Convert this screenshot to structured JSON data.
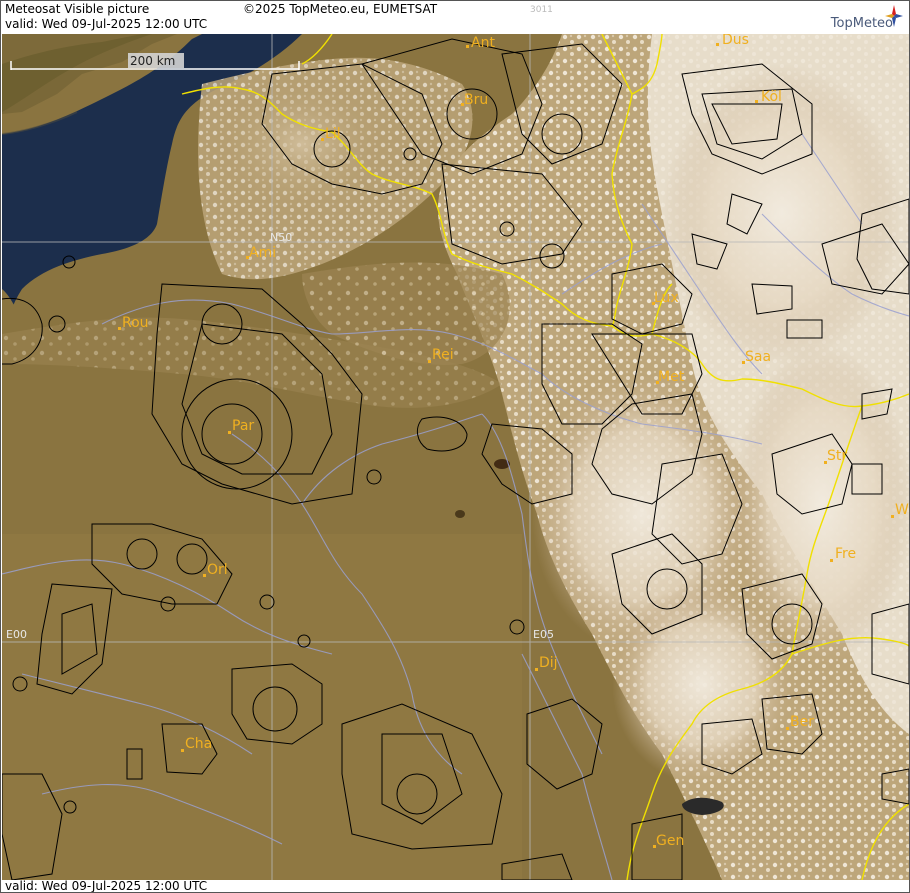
{
  "header": {
    "title": "Meteosat Visible picture",
    "valid": "valid:  Wed  09-Jul-2025  12:00 UTC",
    "copyright": "©2025 TopMeteo.eu, EUMETSAT",
    "code": "3011",
    "logo": "TopMeteo"
  },
  "footer": {
    "valid": "valid:  Wed  09-Jul-2025  12:00 UTC"
  },
  "scale": {
    "label": "200 km"
  },
  "grid_labels": {
    "n50": "N50",
    "e00": "E00",
    "e05": "E05"
  },
  "cities": [
    {
      "name": "Ant"
    },
    {
      "name": "Dus"
    },
    {
      "name": "Bru"
    },
    {
      "name": "Köl"
    },
    {
      "name": "Lil"
    },
    {
      "name": "Ami"
    },
    {
      "name": "Rou"
    },
    {
      "name": "Lux"
    },
    {
      "name": "Rei"
    },
    {
      "name": "Saa"
    },
    {
      "name": "Met"
    },
    {
      "name": "Par"
    },
    {
      "name": "Str"
    },
    {
      "name": "Wi"
    },
    {
      "name": "Orl"
    },
    {
      "name": "Fre"
    },
    {
      "name": "Dij"
    },
    {
      "name": "Ber"
    },
    {
      "name": "Cha"
    },
    {
      "name": "Gen"
    }
  ],
  "colors": {
    "land": "#8a7440",
    "sea": "#1c2e4c",
    "cloud": "#ece4d6",
    "border": "#f0e000",
    "river": "#9aa0d0",
    "airspace": "#000000",
    "city": "#f0b020",
    "grid": "#b8b8b8"
  }
}
